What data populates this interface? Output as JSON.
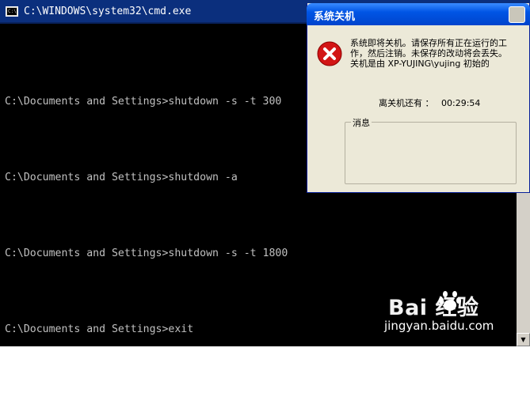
{
  "cmd": {
    "title": "C:\\WINDOWS\\system32\\cmd.exe",
    "icon_label": "C:\\",
    "lines": [
      "C:\\Documents and Settings>shutdown -s -t 300",
      "C:\\Documents and Settings>shutdown -a",
      "C:\\Documents and Settings>shutdown -s -t 1800",
      "C:\\Documents and Settings>exit"
    ]
  },
  "dialog": {
    "title": "系统关机",
    "message_line1": "系统即将关机。请保存所有正在运行的工",
    "message_line2": "作，然后注销。未保存的改动将会丢失。",
    "message_line3": "关机是由 XP-YUJING\\yujing 初始的",
    "countdown_label": "离关机还有 ：",
    "countdown_value": "00:29:54",
    "message_group_label": "消息"
  },
  "watermark": {
    "brand": "Bai 经验",
    "site": "jingyan.baidu.com"
  },
  "colors": {
    "cmd_bg": "#000000",
    "cmd_text": "#c0c0c0",
    "titlebar": "#0b2f7d",
    "dialog_title": "#0055e5",
    "error_red": "#d21515"
  }
}
